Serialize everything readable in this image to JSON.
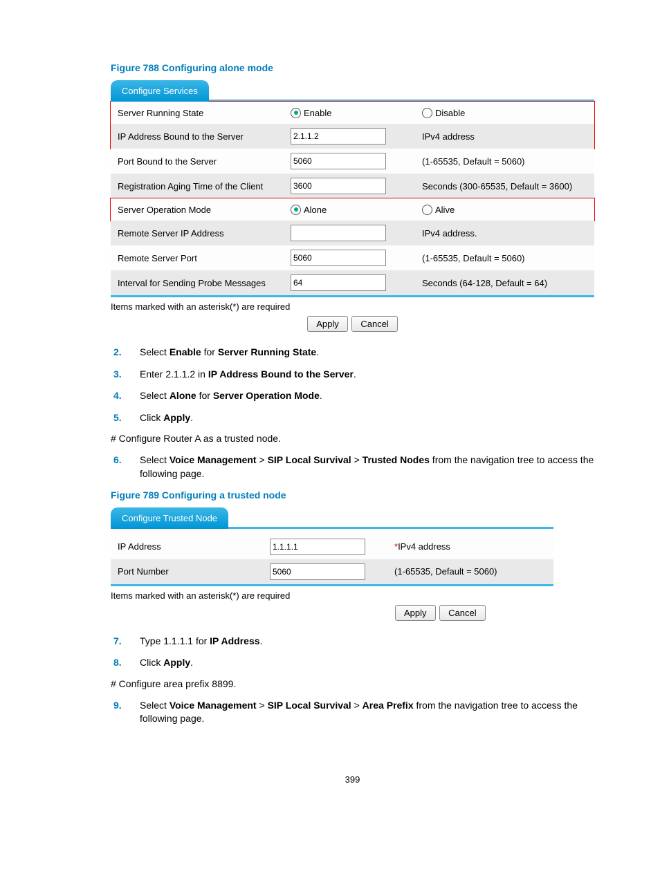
{
  "figure1": {
    "title": "Figure 788 Configuring alone mode",
    "tab": "Configure Services",
    "rows": {
      "server_running_state": "Server Running State",
      "enable": "Enable",
      "disable": "Disable",
      "ip_bound": "IP Address Bound to the Server",
      "ip_bound_val": "2.1.1.2",
      "ipv4_addr": "IPv4 address",
      "port_bound": "Port Bound to the Server",
      "port_bound_val": "5060",
      "port_bound_hint": "(1-65535, Default = 5060)",
      "reg_aging": "Registration Aging Time of the Client",
      "reg_aging_val": "3600",
      "reg_aging_hint": "Seconds (300-65535, Default = 3600)",
      "server_op": "Server Operation Mode",
      "alone": "Alone",
      "alive": "Alive",
      "remote_ip": "Remote Server IP Address",
      "remote_ip_val": "",
      "remote_ip_hint": "IPv4 address.",
      "remote_port": "Remote Server Port",
      "remote_port_val": "5060",
      "remote_port_hint": "(1-65535, Default = 5060)",
      "interval": "Interval for Sending Probe Messages",
      "interval_val": "64",
      "interval_hint": "Seconds (64-128, Default = 64)"
    },
    "footnote": "Items marked with an asterisk(*) are required",
    "apply": "Apply",
    "cancel": "Cancel"
  },
  "steps1": {
    "s2": "Select ",
    "s2b1": "Enable",
    "s2m": " for ",
    "s2b2": "Server Running State",
    "s2e": ".",
    "s3": "Enter 2.1.1.2 in ",
    "s3b": "IP Address Bound to the Server",
    "s3e": ".",
    "s4": "Select ",
    "s4b1": "Alone",
    "s4m": " for ",
    "s4b2": "Server Operation Mode",
    "s4e": ".",
    "s5": "Click ",
    "s5b": "Apply",
    "s5e": ".",
    "hash1": "# Configure Router A as a trusted node.",
    "s6a": "Select ",
    "s6b1": "Voice Management",
    "s6g1": " > ",
    "s6b2": "SIP Local Survival",
    "s6g2": " > ",
    "s6b3": "Trusted Nodes",
    "s6e": " from the navigation tree to access the following page."
  },
  "figure2": {
    "title": "Figure 789 Configuring a trusted node",
    "tab": "Configure Trusted Node",
    "ip_address": "IP Address",
    "ip_address_val": "1.1.1.1",
    "ip_address_hint": "IPv4 address",
    "port_number": "Port Number",
    "port_number_val": "5060",
    "port_number_hint": "(1-65535, Default = 5060)",
    "footnote": "Items marked with an asterisk(*) are required",
    "apply": "Apply",
    "cancel": "Cancel"
  },
  "steps2": {
    "s7": "Type 1.1.1.1 for ",
    "s7b": "IP Address",
    "s7e": ".",
    "s8": "Click ",
    "s8b": "Apply",
    "s8e": ".",
    "hash2": "# Configure area prefix 8899.",
    "s9a": "Select ",
    "s9b1": "Voice Management",
    "s9g1": " > ",
    "s9b2": "SIP Local Survival",
    "s9g2": " > ",
    "s9b3": "Area Prefix",
    "s9e": " from the navigation tree to access the following page."
  },
  "page_number": "399"
}
